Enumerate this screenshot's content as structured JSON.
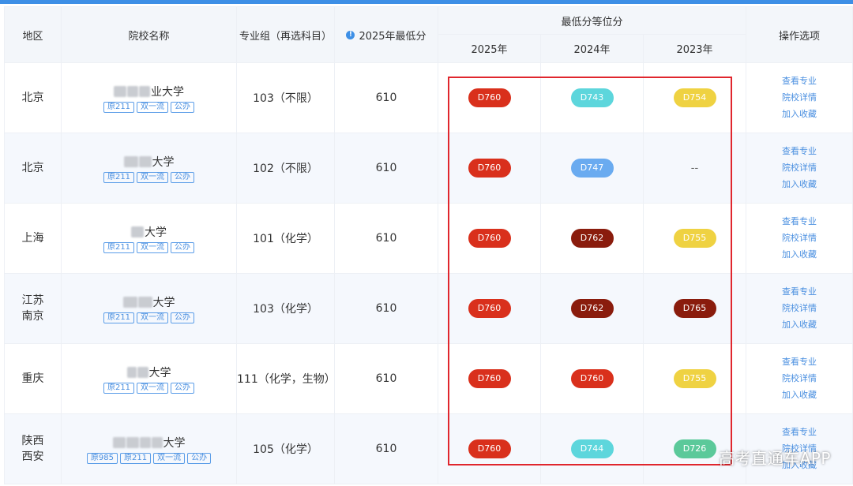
{
  "headers": {
    "region": "地区",
    "school": "院校名称",
    "group": "专业组（再选科目）",
    "min_score": "2025年最低分",
    "equiv_rank": "最低分等位分",
    "y2025": "2025年",
    "y2024": "2024年",
    "y2023": "2023年",
    "ops": "操作选项"
  },
  "ops_labels": {
    "view_majors": "查看专业",
    "school_detail": "院校详情",
    "favorite": "加入收藏"
  },
  "rows": [
    {
      "region": [
        "北京"
      ],
      "school_suffix": "业大学",
      "tags": [
        "原211",
        "双一流",
        "公办"
      ],
      "group": "103（不限）",
      "min_score": "610",
      "ranks": [
        {
          "value": "D760",
          "color": "#d9301c"
        },
        {
          "value": "D743",
          "color": "#5dd6dc"
        },
        {
          "value": "D754",
          "color": "#efd242"
        }
      ]
    },
    {
      "region": [
        "北京"
      ],
      "school_suffix": "大学",
      "tags": [
        "原211",
        "双一流",
        "公办"
      ],
      "group": "102（不限）",
      "min_score": "610",
      "ranks": [
        {
          "value": "D760",
          "color": "#d9301c"
        },
        {
          "value": "D747",
          "color": "#6aabf0"
        },
        {
          "value": "--",
          "color": ""
        }
      ]
    },
    {
      "region": [
        "上海"
      ],
      "school_suffix": "大学",
      "tags": [
        "原211",
        "双一流",
        "公办"
      ],
      "group": "101（化学）",
      "min_score": "610",
      "ranks": [
        {
          "value": "D760",
          "color": "#d9301c"
        },
        {
          "value": "D762",
          "color": "#8a1c0d"
        },
        {
          "value": "D755",
          "color": "#efd242"
        }
      ]
    },
    {
      "region": [
        "江苏",
        "南京"
      ],
      "school_suffix": "大学",
      "tags": [
        "原211",
        "双一流",
        "公办"
      ],
      "group": "103（化学）",
      "min_score": "610",
      "ranks": [
        {
          "value": "D760",
          "color": "#d9301c"
        },
        {
          "value": "D762",
          "color": "#8a1c0d"
        },
        {
          "value": "D765",
          "color": "#8a1c0d"
        }
      ]
    },
    {
      "region": [
        "重庆"
      ],
      "school_suffix": "大学",
      "tags": [
        "原211",
        "双一流",
        "公办"
      ],
      "group": "111（化学，生物）",
      "min_score": "610",
      "ranks": [
        {
          "value": "D760",
          "color": "#d9301c"
        },
        {
          "value": "D760",
          "color": "#d9301c"
        },
        {
          "value": "D755",
          "color": "#efd242"
        }
      ]
    },
    {
      "region": [
        "陕西",
        "西安"
      ],
      "school_suffix": "大学",
      "tags": [
        "原985",
        "原211",
        "双一流",
        "公办"
      ],
      "group": "105（化学）",
      "min_score": "610",
      "ranks": [
        {
          "value": "D760",
          "color": "#d9301c"
        },
        {
          "value": "D744",
          "color": "#5dd6dc"
        },
        {
          "value": "D726",
          "color": "#5bc99a"
        }
      ]
    }
  ],
  "watermark": "高考直通车APP"
}
